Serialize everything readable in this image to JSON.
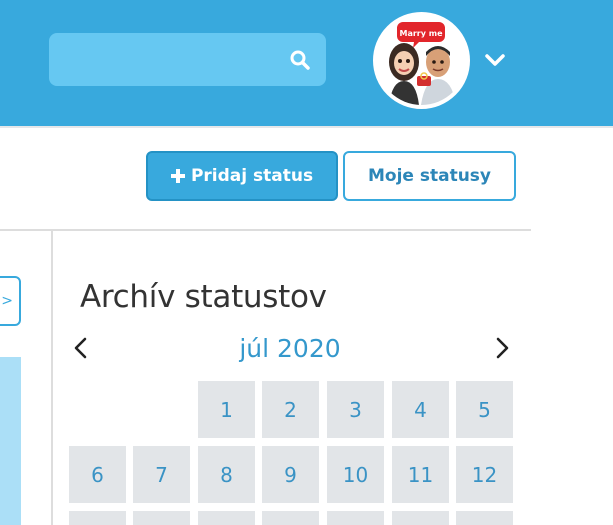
{
  "header": {
    "search": {
      "placeholder": "",
      "value": ""
    },
    "avatar_caption": "Marry me"
  },
  "actions": {
    "add_status_label": "Pridaj status",
    "my_statuses_label": "Moje statusy"
  },
  "sidebar": {
    "toggle_label": ">"
  },
  "archive": {
    "title": "Archív statustov",
    "month_label": "júl 2020",
    "days": [
      "1",
      "2",
      "3",
      "4",
      "5",
      "6",
      "7",
      "8",
      "9",
      "10",
      "11",
      "12"
    ]
  },
  "colors": {
    "accent": "#38a9dd",
    "search_bg": "#66c8f2",
    "day_bg": "#e2e5e8",
    "day_text": "#3a93c5"
  }
}
